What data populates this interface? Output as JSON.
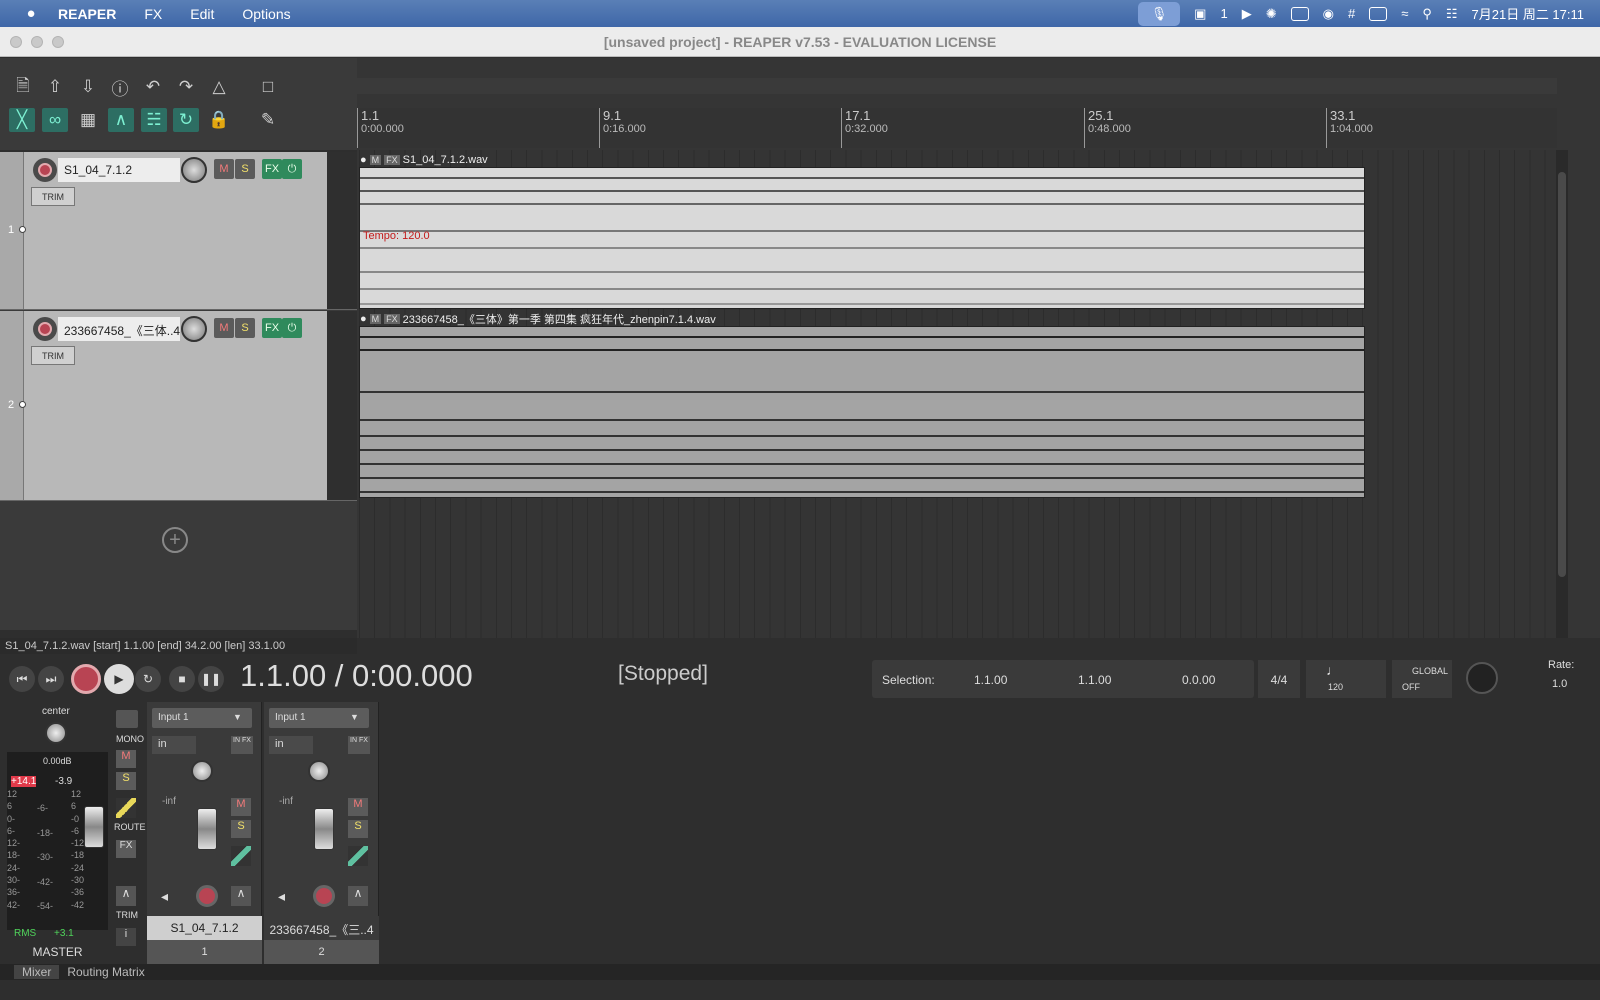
{
  "menubar": {
    "apple": "",
    "app": "REAPER",
    "menus": [
      "FX",
      "Edit",
      "Options"
    ],
    "notification_count": "1",
    "clock": "7月21日 周二 17:11"
  },
  "window": {
    "title": "[unsaved project] - REAPER v7.53 - EVALUATION LICENSE"
  },
  "ruler": {
    "markers": [
      {
        "bar": "1.1",
        "time": "0:00.000"
      },
      {
        "bar": "9.1",
        "time": "0:16.000"
      },
      {
        "bar": "17.1",
        "time": "0:32.000"
      },
      {
        "bar": "25.1",
        "time": "0:48.000"
      },
      {
        "bar": "33.1",
        "time": "1:04.000"
      }
    ]
  },
  "tracks": [
    {
      "number": "1",
      "name": "S1_04_7.1.2",
      "trim": "TRIM",
      "m": "M",
      "s": "S",
      "fx": "FX",
      "power": "⏻"
    },
    {
      "number": "2",
      "name": "233667458_《三体..4",
      "trim": "TRIM",
      "m": "M",
      "s": "S",
      "fx": "FX",
      "power": "⏻"
    }
  ],
  "items": [
    {
      "m": "M",
      "fx": "FX",
      "name": "S1_04_7.1.2.wav",
      "tempo": "Tempo: 120.0"
    },
    {
      "m": "M",
      "fx": "FX",
      "name": "233667458_《三体》第一季 第四集 疯狂年代_zhenpin7.1.4.wav"
    }
  ],
  "status_line": "S1_04_7.1.2.wav [start] 1.1.00 [end] 34.2.00 [len] 33.1.00",
  "transport": {
    "position": "1.1.00 / 0:00.000",
    "state": "[Stopped]",
    "selection_label": "Selection:",
    "sel_start": "1.1.00",
    "sel_end": "1.1.00",
    "sel_len": "0.0.00",
    "time_sig": "4/4",
    "bpm": "120",
    "global_label": "GLOBAL",
    "global_value": "OFF",
    "rate_label": "Rate:",
    "rate_value": "1.0"
  },
  "master": {
    "pan": "center",
    "db": "0.00dB",
    "peak_l": "+14.1",
    "peak_r": "-3.9",
    "mono": "MONO",
    "m": "M",
    "s": "S",
    "route": "ROUTE",
    "fx": "FX",
    "trim": "TRIM",
    "rms_label": "RMS",
    "rms_value": "+3.1",
    "name": "MASTER",
    "scale_left": [
      "12",
      "6",
      "0-",
      "6-",
      "12-",
      "18-",
      "24-",
      "30-",
      "36-",
      "42-"
    ],
    "scale_mid": [
      "-6-",
      "-18-",
      "-30-",
      "-42-",
      "-54-"
    ],
    "scale_right": [
      "12",
      "6",
      "-0",
      "-6",
      "-12",
      "-18",
      "-24",
      "-30",
      "-36",
      "-42"
    ]
  },
  "mixer_channels": [
    {
      "input": "Input 1",
      "in": "in",
      "infx": "IN FX",
      "level": "-inf",
      "m": "M",
      "s": "S",
      "name": "S1_04_7.1.2",
      "number": "1"
    },
    {
      "input": "Input 1",
      "in": "in",
      "infx": "IN FX",
      "level": "-inf",
      "m": "M",
      "s": "S",
      "name": "233667458_《三..4",
      "number": "2"
    }
  ],
  "bottom_tabs": [
    "Mixer",
    "Routing Matrix"
  ],
  "colors": {
    "accent_green": "#2f8a5c",
    "record_red": "#b84453",
    "tempo_red": "#c41b1b",
    "item_light": "#d9d9d9",
    "item_gray": "#a4a4a4"
  }
}
